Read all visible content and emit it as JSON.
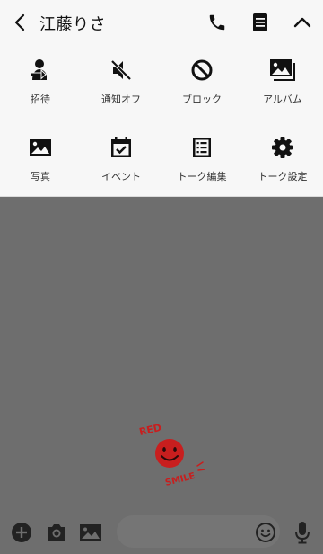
{
  "header": {
    "title": "江藤りさ"
  },
  "menu": {
    "items": [
      {
        "label": "招待",
        "icon": "invite-icon"
      },
      {
        "label": "通知オフ",
        "icon": "mute-icon"
      },
      {
        "label": "ブロック",
        "icon": "block-icon"
      },
      {
        "label": "アルバム",
        "icon": "album-icon"
      },
      {
        "label": "写真",
        "icon": "photo-icon"
      },
      {
        "label": "イベント",
        "icon": "calendar-icon"
      },
      {
        "label": "トーク編集",
        "icon": "edit-list-icon"
      },
      {
        "label": "トーク設定",
        "icon": "gear-icon"
      }
    ]
  },
  "sticker": {
    "top_text": "RED",
    "bottom_text": "SMILE"
  },
  "colors": {
    "header_bg": "#f7f7f7",
    "chat_bg": "#6e6e6e",
    "sticker_red": "#c81e1e"
  }
}
